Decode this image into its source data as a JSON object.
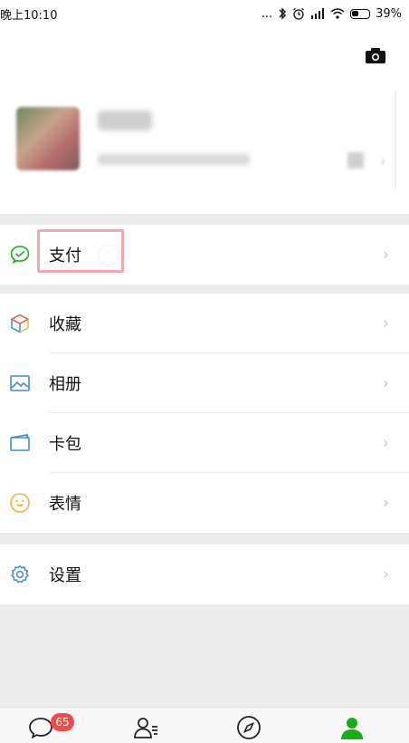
{
  "status_bar": {
    "time": "晚上10:10",
    "dots": "...",
    "battery": "39%"
  },
  "profile": {
    "camera_icon": "camera-icon",
    "chevron": "›"
  },
  "menu": {
    "pay": {
      "label": "支付",
      "icon": "wechat-pay-icon"
    },
    "items": [
      {
        "label": "收藏",
        "icon": "favorites-cube-icon"
      },
      {
        "label": "相册",
        "icon": "album-picture-icon"
      },
      {
        "label": "卡包",
        "icon": "card-wallet-icon"
      },
      {
        "label": "表情",
        "icon": "sticker-smiley-icon"
      }
    ],
    "settings": {
      "label": "设置",
      "icon": "gear-icon"
    },
    "chevron": "›"
  },
  "tabbar": {
    "chats_badge": "65",
    "tabs": [
      "chats-icon",
      "contacts-icon",
      "discover-icon",
      "me-icon"
    ],
    "active_color": "#1aad19"
  },
  "colors": {
    "highlight": "#f0a9ae",
    "badge": "#f04b4b",
    "accent_green": "#1aad19"
  }
}
